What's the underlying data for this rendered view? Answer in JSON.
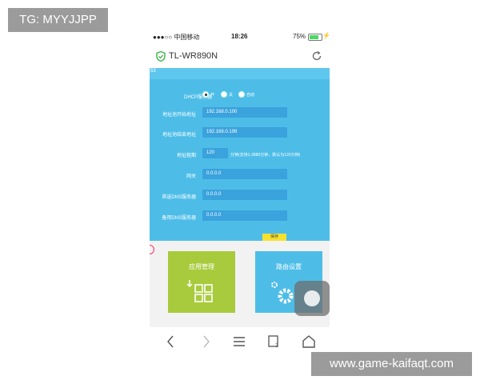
{
  "watermarks": {
    "top": "TG: MYYJJPP",
    "bottom": "www.game-kaifaqt.com"
  },
  "status_bar": {
    "carrier": "●●●○○ 中国移动",
    "time": "18:26",
    "battery": "75%"
  },
  "header": {
    "title": "TL-WR890N"
  },
  "panel": {
    "tag": "53",
    "dhcp": {
      "label": "DHCP服务器",
      "options": [
        "开",
        "关",
        "自动"
      ],
      "selected": "开"
    },
    "start_ip": {
      "label": "地址池开始地址",
      "value": "192.168.0.100"
    },
    "end_ip": {
      "label": "地址池结束地址",
      "value": "192.168.0.199"
    },
    "lease": {
      "label": "地址租期",
      "value": "120",
      "hint": "分钟(支持1-2880分钟，默认为120分钟)"
    },
    "gateway": {
      "label": "网关",
      "value": "0.0.0.0"
    },
    "dns_primary": {
      "label": "首选DNS服务器",
      "value": "0.0.0.0"
    },
    "dns_secondary": {
      "label": "备用DNS服务器",
      "value": "0.0.0.0"
    },
    "save_label": "保存"
  },
  "tiles": {
    "app_manage": "应用管理",
    "router_settings": "路由设置"
  },
  "colors": {
    "panel": "#4dbde8",
    "field": "#3aa2dc",
    "green_tile": "#a8cb3d",
    "save": "#f6e12e"
  }
}
